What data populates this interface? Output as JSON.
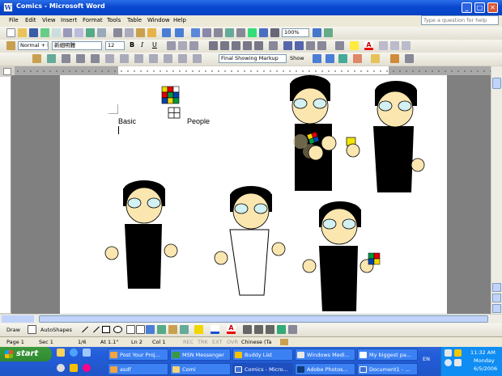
{
  "window": {
    "title": "Comics - Microsoft Word",
    "minimize": "_",
    "maximize": "□",
    "close": "✕"
  },
  "menu": [
    {
      "key": "F",
      "rest": "ile"
    },
    {
      "key": "E",
      "rest": "dit"
    },
    {
      "key": "V",
      "rest": "iew"
    },
    {
      "key": "I",
      "rest": "nsert"
    },
    {
      "key": "F",
      "rest": "ormat",
      "pre": ""
    },
    {
      "key": "T",
      "rest": "ools"
    },
    {
      "key": "T",
      "rest": "able",
      "pre": ""
    },
    {
      "key": "W",
      "rest": "indow"
    },
    {
      "key": "H",
      "rest": "elp"
    }
  ],
  "menu_labels": [
    "File",
    "Edit",
    "View",
    "Insert",
    "Format",
    "Tools",
    "Table",
    "Window",
    "Help"
  ],
  "question_box": {
    "placeholder": "Type a question for help"
  },
  "formatting": {
    "style": "Normal + I",
    "font": "新細明體",
    "size": "12",
    "zoom": "100%",
    "markup": "Final Showing Markup",
    "show": "Show"
  },
  "document": {
    "text_basic": "Basic",
    "text_people": "People"
  },
  "drawing_toolbar": {
    "draw": "Draw",
    "autoshapes": "AutoShapes"
  },
  "status": {
    "page": "Page 1",
    "sec": "Sec 1",
    "pages": "1/6",
    "at": "At 1.1\"",
    "ln": "Ln 2",
    "col": "Col 1",
    "rec": "REC",
    "trk": "TRK",
    "ext": "EXT",
    "ovr": "OVR",
    "language": "Chinese (Ta"
  },
  "taskbar": {
    "start": "start",
    "row1": [
      "Post Your Proj...",
      "MSN Messenger",
      "Buddy List",
      "Windows Medi...",
      "My biggest pa..."
    ],
    "row2": [
      "asdf",
      "Comi",
      "Comics - Micro...",
      "Adobe Photos...",
      "Document1 - ..."
    ],
    "lang": "EN",
    "time": "11:32 AM",
    "day": "Monday",
    "date": "6/5/2006"
  },
  "colors": {
    "titlebar": "#0a48d0",
    "taskbar": "#245edc",
    "start": "#2f8a2f",
    "face": "#fbe6b0"
  }
}
